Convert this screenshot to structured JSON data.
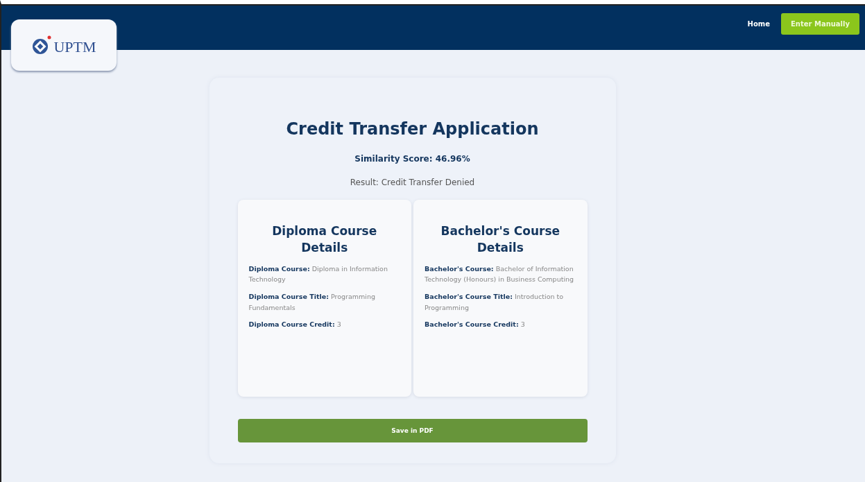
{
  "header": {
    "logo": "UPTM",
    "nav": [
      {
        "label": "Home",
        "kind": "link"
      },
      {
        "label": "Enter Manually",
        "kind": "button"
      }
    ]
  },
  "title": "Credit Transfer Application",
  "score": "Similarity Score: 46.96%",
  "result": "Result: Credit Transfer Denied",
  "cards": [
    {
      "heading": "Diploma Course Details",
      "fields": [
        {
          "label": "Diploma Course:",
          "value": "Diploma in Information Technology"
        },
        {
          "label": "Diploma Course Title:",
          "value": "Programming Fundamentals"
        },
        {
          "label": "Diploma Course Credit:",
          "value": "3"
        }
      ]
    },
    {
      "heading": "Bachelor's Course Details",
      "fields": [
        {
          "label": "Bachelor's Course:",
          "value": "Bachelor of Information Technology (Honours) in Business Computing"
        },
        {
          "label": "Bachelor's Course Title:",
          "value": "Introduction to Programming"
        },
        {
          "label": "Bachelor's Course Credit:",
          "value": "3"
        }
      ]
    }
  ],
  "save_button": "Save in PDF"
}
